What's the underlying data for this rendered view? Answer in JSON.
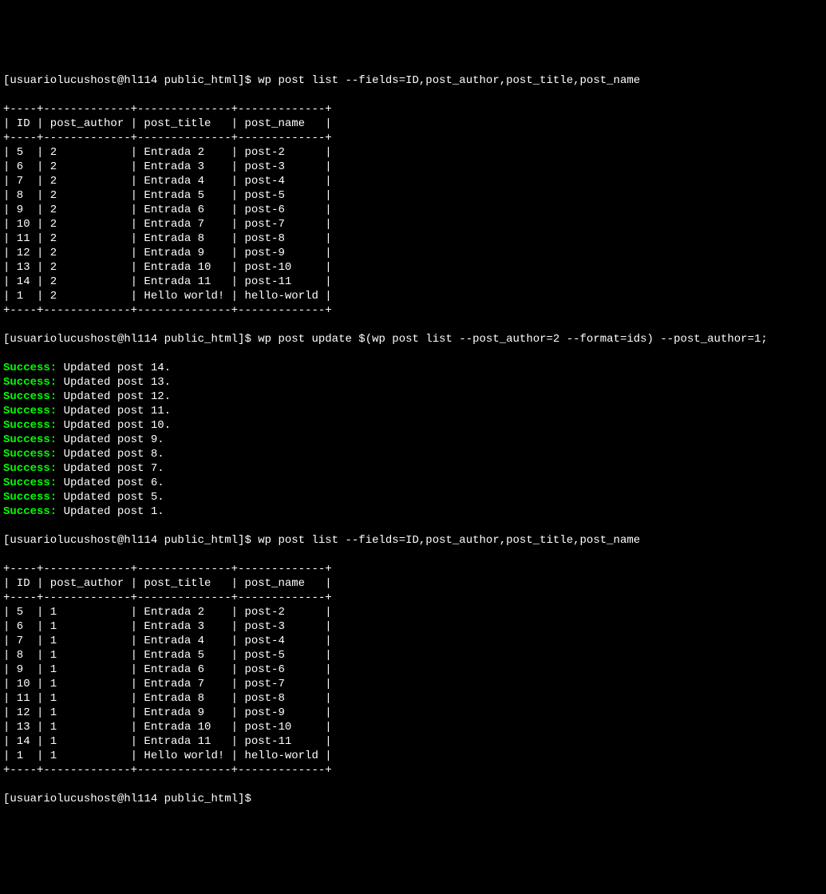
{
  "prompt": "[usuariolucushost@hl114 public_html]$ ",
  "commands": {
    "cmd1": "wp post list --fields=ID,post_author,post_title,post_name",
    "cmd2": "wp post update $(wp post list --post_author=2 --format=ids) --post_author=1;",
    "cmd3": "wp post list --fields=ID,post_author,post_title,post_name",
    "cmd4": ""
  },
  "table": {
    "divider": "+----+-------------+--------------+-------------+",
    "header": "| ID | post_author | post_title   | post_name   |",
    "columns": [
      "ID",
      "post_author",
      "post_title",
      "post_name"
    ]
  },
  "table1_rows": [
    {
      "id": "5",
      "author": "2",
      "title": "Entrada 2",
      "name": "post-2"
    },
    {
      "id": "6",
      "author": "2",
      "title": "Entrada 3",
      "name": "post-3"
    },
    {
      "id": "7",
      "author": "2",
      "title": "Entrada 4",
      "name": "post-4"
    },
    {
      "id": "8",
      "author": "2",
      "title": "Entrada 5",
      "name": "post-5"
    },
    {
      "id": "9",
      "author": "2",
      "title": "Entrada 6",
      "name": "post-6"
    },
    {
      "id": "10",
      "author": "2",
      "title": "Entrada 7",
      "name": "post-7"
    },
    {
      "id": "11",
      "author": "2",
      "title": "Entrada 8",
      "name": "post-8"
    },
    {
      "id": "12",
      "author": "2",
      "title": "Entrada 9",
      "name": "post-9"
    },
    {
      "id": "13",
      "author": "2",
      "title": "Entrada 10",
      "name": "post-10"
    },
    {
      "id": "14",
      "author": "2",
      "title": "Entrada 11",
      "name": "post-11"
    },
    {
      "id": "1",
      "author": "2",
      "title": "Hello world!",
      "name": "hello-world"
    }
  ],
  "success_label": "Success:",
  "success_messages": [
    "Updated post 14.",
    "Updated post 13.",
    "Updated post 12.",
    "Updated post 11.",
    "Updated post 10.",
    "Updated post 9.",
    "Updated post 8.",
    "Updated post 7.",
    "Updated post 6.",
    "Updated post 5.",
    "Updated post 1."
  ],
  "table2_rows": [
    {
      "id": "5",
      "author": "1",
      "title": "Entrada 2",
      "name": "post-2"
    },
    {
      "id": "6",
      "author": "1",
      "title": "Entrada 3",
      "name": "post-3"
    },
    {
      "id": "7",
      "author": "1",
      "title": "Entrada 4",
      "name": "post-4"
    },
    {
      "id": "8",
      "author": "1",
      "title": "Entrada 5",
      "name": "post-5"
    },
    {
      "id": "9",
      "author": "1",
      "title": "Entrada 6",
      "name": "post-6"
    },
    {
      "id": "10",
      "author": "1",
      "title": "Entrada 7",
      "name": "post-7"
    },
    {
      "id": "11",
      "author": "1",
      "title": "Entrada 8",
      "name": "post-8"
    },
    {
      "id": "12",
      "author": "1",
      "title": "Entrada 9",
      "name": "post-9"
    },
    {
      "id": "13",
      "author": "1",
      "title": "Entrada 10",
      "name": "post-10"
    },
    {
      "id": "14",
      "author": "1",
      "title": "Entrada 11",
      "name": "post-11"
    },
    {
      "id": "1",
      "author": "1",
      "title": "Hello world!",
      "name": "hello-world"
    }
  ]
}
